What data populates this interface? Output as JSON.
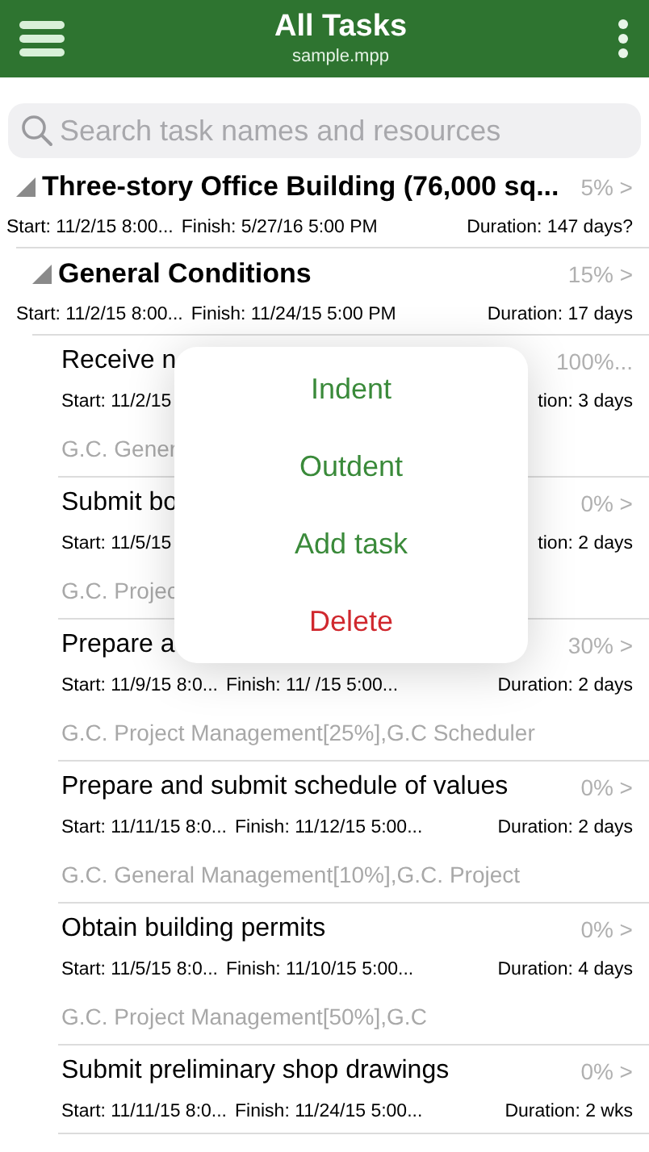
{
  "header": {
    "title": "All Tasks",
    "subtitle": "sample.mpp"
  },
  "search": {
    "placeholder": "Search task names and resources"
  },
  "tasks": [
    {
      "kind": "summary",
      "expanded": true,
      "name": "Three-story Office Building (76,000 sq...",
      "percent": "5% >",
      "start": "Start: 11/2/15 8:00...",
      "finish": "Finish: 5/27/16 5:00 PM",
      "duration": "Duration: 147 days?",
      "children": [
        {
          "kind": "summary",
          "expanded": true,
          "name": "General Conditions",
          "percent": "15% >",
          "start": "Start: 11/2/15 8:00...",
          "finish": "Finish: 11/24/15 5:00 PM",
          "duration": "Duration: 17 days",
          "children": [
            {
              "kind": "task",
              "name": "Receive n",
              "percent": "100%...",
              "start": "Start: 11/2/15",
              "duration": "tion: 3 days",
              "resources": "G.C. Gener"
            },
            {
              "kind": "task",
              "name": "Submit bo",
              "percent": "0% >",
              "start": "Start: 11/5/15",
              "duration": "tion: 2 days",
              "resources": "G.C. Projec"
            },
            {
              "kind": "task",
              "name": "Prepare a",
              "percent": "30% >",
              "start": "Start: 11/9/15 8:0...",
              "finish": "Finish: 11/  /15 5:00...",
              "duration": "Duration: 2 days",
              "resources": "G.C. Project Management[25%],G.C Scheduler"
            },
            {
              "kind": "task",
              "name": "Prepare and submit schedule of values",
              "percent": "0% >",
              "start": "Start: 11/11/15 8:0...",
              "finish": "Finish: 11/12/15 5:00...",
              "duration": "Duration: 2 days",
              "resources": "G.C. General Management[10%],G.C. Project"
            },
            {
              "kind": "task",
              "name": "Obtain building permits",
              "percent": "0% >",
              "start": "Start: 11/5/15 8:0...",
              "finish": "Finish: 11/10/15 5:00...",
              "duration": "Duration: 4 days",
              "resources": "G.C. Project Management[50%],G.C"
            },
            {
              "kind": "task",
              "name": "Submit preliminary shop drawings",
              "percent": "0% >",
              "start": "Start: 11/11/15 8:0...",
              "finish": "Finish: 11/24/15 5:00...",
              "duration": "Duration: 2 wks"
            }
          ]
        }
      ]
    }
  ],
  "menu": [
    {
      "label": "Indent",
      "kind": "normal"
    },
    {
      "label": "Outdent",
      "kind": "normal"
    },
    {
      "label": "Add task",
      "kind": "normal"
    },
    {
      "label": "Delete",
      "kind": "destructive"
    }
  ]
}
